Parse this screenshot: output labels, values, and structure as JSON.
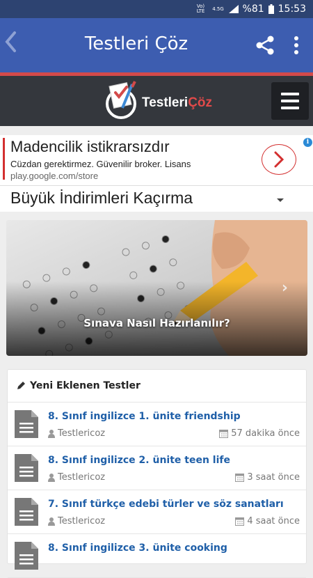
{
  "status": {
    "lte": "Vo) LTE",
    "signal": "4.5G",
    "battery": "%81",
    "time": "15:53"
  },
  "appbar": {
    "back_icon": "chevron-left-icon",
    "title": "Testleri Çöz",
    "share_icon": "share-icon",
    "menu_icon": "more-vertical-icon"
  },
  "site": {
    "logo_text_a": "Testleri",
    "logo_text_b": "Çöz",
    "accent": "#d34a4a"
  },
  "ad": {
    "headline": "Madencilik istikrarsızdır",
    "description": "Cüzdan gerektirmez. Güvenilir broker. Lisans",
    "url": "play.google.com/store",
    "info": "i"
  },
  "select": {
    "label": "Büyük İndirimleri Kaçırma"
  },
  "slider": {
    "caption": "Sınava Nasıl Hazırlanılır?",
    "next": "›"
  },
  "latest": {
    "header": "Yeni Eklenen Testler",
    "items": [
      {
        "title": "8. Sınıf ingilizce 1. ünite friendship",
        "author": "Testlericoz",
        "time": "57 dakika önce"
      },
      {
        "title": "8. Sınıf ingilizce 2. ünite teen life",
        "author": "Testlericoz",
        "time": "3 saat önce"
      },
      {
        "title": "7. Sınıf türkçe edebi türler ve söz sanatları",
        "author": "Testlericoz",
        "time": "4 saat önce"
      },
      {
        "title": "8. Sınıf ingilizce 3. ünite cooking",
        "author": "",
        "time": ""
      }
    ]
  }
}
